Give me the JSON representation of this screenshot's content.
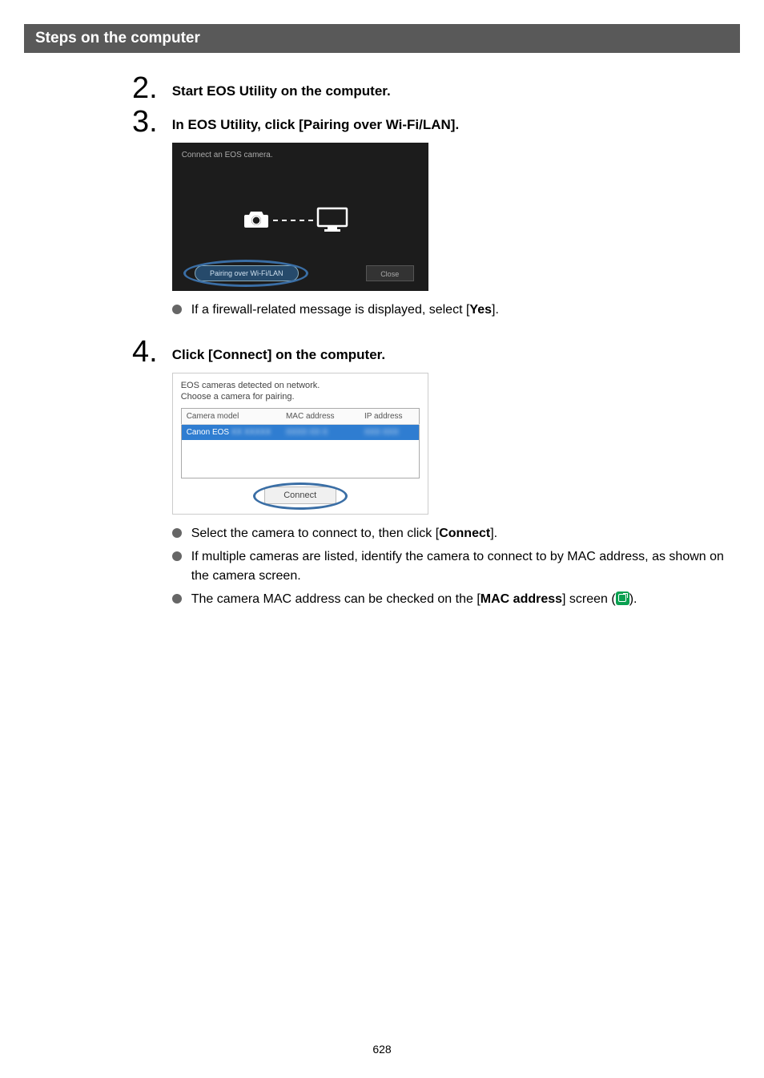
{
  "section_header": "Steps on the computer",
  "steps": {
    "s2": {
      "num": "2",
      "heading": "Start EOS Utility on the computer."
    },
    "s3": {
      "num": "3",
      "heading": "In EOS Utility, click [Pairing over Wi-Fi/LAN]."
    },
    "s4": {
      "num": "4",
      "heading": "Click [Connect] on the computer."
    }
  },
  "eos_dark": {
    "title": "Connect an EOS camera.",
    "pairing_btn": "Pairing over Wi-Fi/LAN",
    "close_btn": "Close"
  },
  "eos_white": {
    "title_line1": "EOS cameras detected on network.",
    "title_line2": "Choose a camera for pairing.",
    "col1": "Camera model",
    "col2": "MAC address",
    "col3": "IP address",
    "row_model": "Canon EOS",
    "connect_btn": "Connect"
  },
  "bullets": {
    "b3_1_pre": "If a firewall-related message is displayed, select [",
    "b3_1_bold": "Yes",
    "b3_1_post": "].",
    "b4_1_pre": "Select the camera to connect to, then click [",
    "b4_1_bold": "Connect",
    "b4_1_post": "].",
    "b4_2": "If multiple cameras are listed, identify the camera to connect to by MAC address, as shown on the camera screen.",
    "b4_3_pre": "The camera MAC address can be checked on the [",
    "b4_3_bold": "MAC address",
    "b4_3_mid": "] screen (",
    "b4_3_post": ")."
  },
  "page_number": "628"
}
